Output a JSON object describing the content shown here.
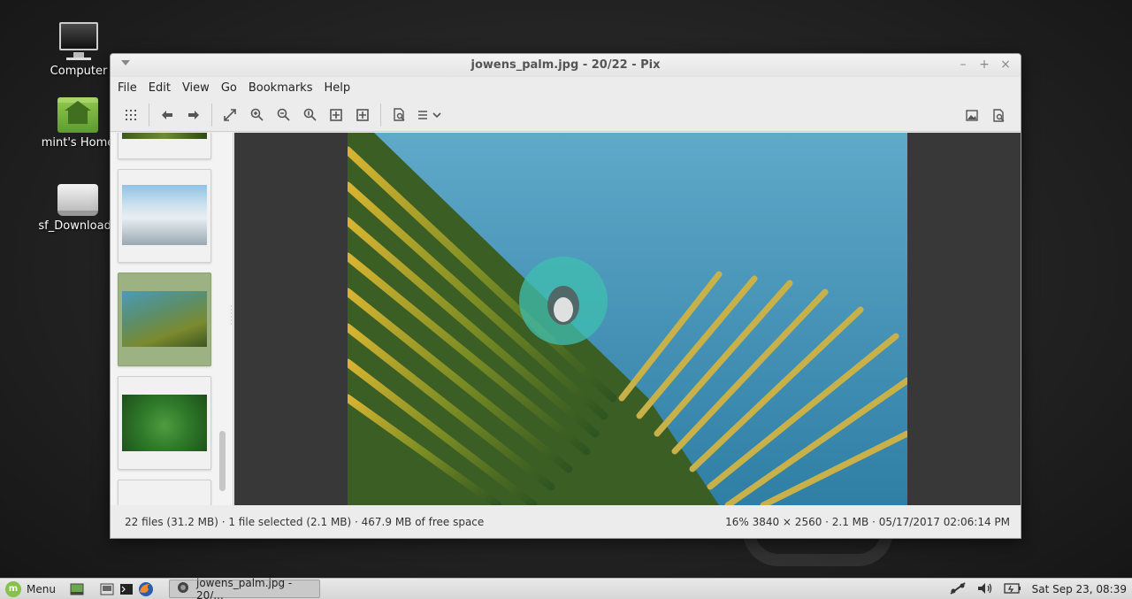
{
  "desktop": {
    "icons": [
      {
        "label": "Computer"
      },
      {
        "label": "mint's Home"
      },
      {
        "label": "sf_Downloads"
      }
    ]
  },
  "window": {
    "title": "jowens_palm.jpg - 20/22 - Pix",
    "controls": {
      "minimize": "–",
      "maximize": "+",
      "close": "×"
    },
    "menu": [
      "File",
      "Edit",
      "View",
      "Go",
      "Bookmarks",
      "Help"
    ],
    "toolbar": {
      "icons": [
        "grid-icon",
        "back-icon",
        "forward-icon",
        "fullscreen-icon",
        "zoom-in-icon",
        "zoom-out-icon",
        "zoom-100-icon",
        "zoom-fit-icon",
        "zoom-fit-width-icon",
        "properties-icon",
        "menu-icon",
        "image-icon",
        "file-icon"
      ]
    },
    "status": {
      "left": "22 files (31.2 MB) · 1 file selected (2.1 MB) · 467.9 MB of free space",
      "right": "16%  3840 × 2560 · 2.1 MB · 05/17/2017 02:06:14 PM"
    }
  },
  "taskbar": {
    "menu_label": "Menu",
    "task_label": "jowens_palm.jpg - 20/...",
    "clock": "Sat Sep 23, 08:39"
  },
  "colors": {
    "selection": "#9cb283",
    "mint": "#87c04b"
  }
}
